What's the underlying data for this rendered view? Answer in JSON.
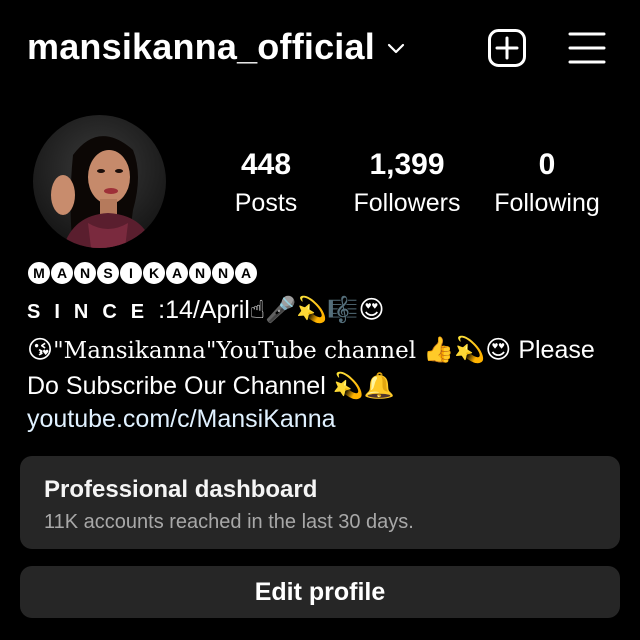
{
  "header": {
    "username": "mansikanna_official",
    "add_icon": "plus-square-icon",
    "menu_icon": "hamburger-menu-icon",
    "dropdown_icon": "chevron-down-icon"
  },
  "profile": {
    "avatar_icon": "profile-photo"
  },
  "stats": [
    {
      "value": "448",
      "label": "Posts"
    },
    {
      "value": "1,399",
      "label": "Followers"
    },
    {
      "value": "0",
      "label": "Following"
    }
  ],
  "bio": {
    "name_letters": [
      "M",
      "A",
      "N",
      "S",
      "I",
      "K",
      "A",
      "N",
      "N",
      "A"
    ],
    "since_letters": "SINCE",
    "since_date": ":14/April",
    "since_emojis": "☝🎤💫🎼😍",
    "line3_emoji_start": "😘",
    "line3_channel": "\"Mansikanna\"YouTube channel",
    "line3_emojis": "👍💫😍",
    "line3_text": "Please",
    "line4_text": "Do Subscribe Our Channel",
    "line4_emojis": "💫🔔",
    "link": "youtube.com/c/MansiKanna"
  },
  "dashboard": {
    "title": "Professional dashboard",
    "subtitle": "11K accounts reached in the last 30 days."
  },
  "edit_profile_label": "Edit profile",
  "colors": {
    "background": "#000000",
    "card": "#262626",
    "subtext": "#a8a8a8",
    "link": "#e0f1ff"
  }
}
